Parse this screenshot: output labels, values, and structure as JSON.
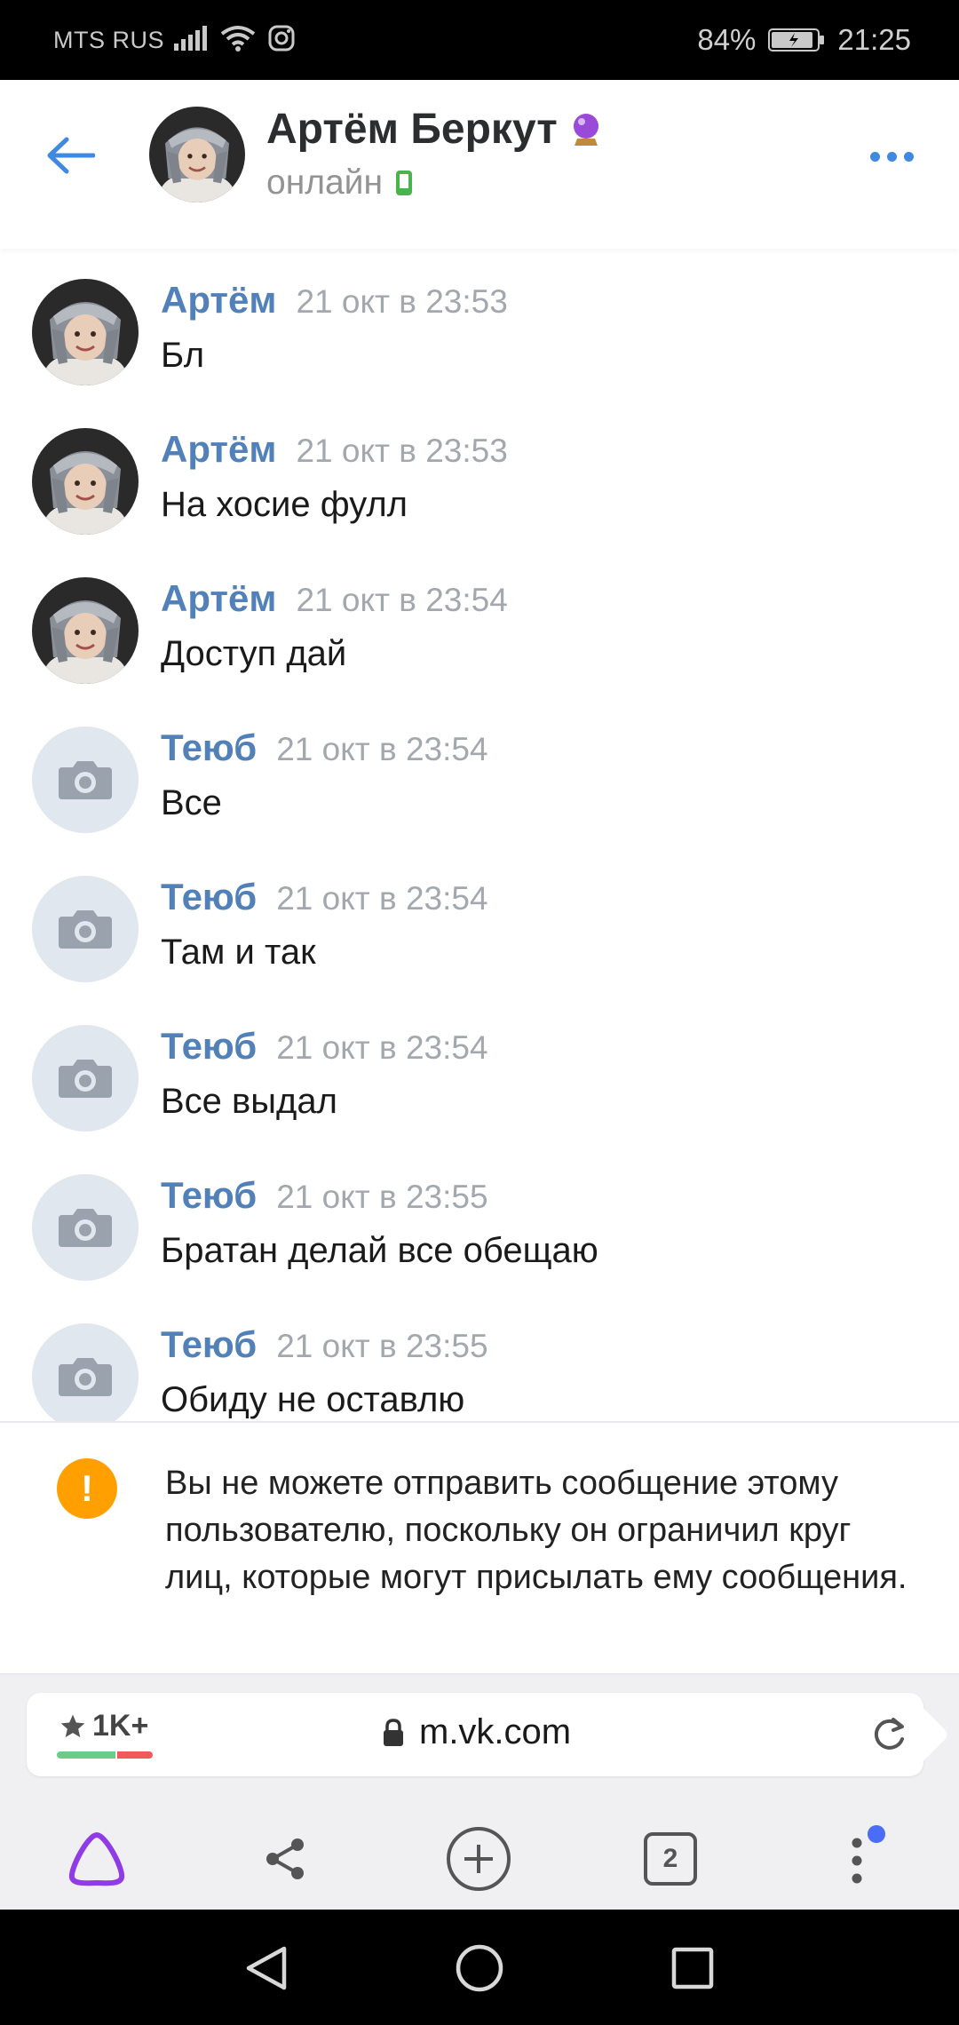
{
  "status_bar": {
    "carrier": "MTS RUS",
    "battery": "84%",
    "time": "21:25"
  },
  "header": {
    "name": "Артём Беркут",
    "status": "онлайн"
  },
  "messages": [
    {
      "author": "Артём",
      "time": "21 окт в 23:53",
      "text": "Бл",
      "avatar": "photo"
    },
    {
      "author": "Артём",
      "time": "21 окт в 23:53",
      "text": "На хосие фулл",
      "avatar": "photo"
    },
    {
      "author": "Артём",
      "time": "21 окт в 23:54",
      "text": "Доступ дай",
      "avatar": "photo"
    },
    {
      "author": "Теюб",
      "time": "21 окт в 23:54",
      "text": "Все",
      "avatar": "camera-placeholder"
    },
    {
      "author": "Теюб",
      "time": "21 окт в 23:54",
      "text": "Там и так",
      "avatar": "camera-placeholder"
    },
    {
      "author": "Теюб",
      "time": "21 окт в 23:54",
      "text": "Все выдал",
      "avatar": "camera-placeholder"
    },
    {
      "author": "Теюб",
      "time": "21 окт в 23:55",
      "text": "Братан делай все обещаю",
      "avatar": "camera-placeholder"
    },
    {
      "author": "Теюб",
      "time": "21 окт в 23:55",
      "text": "Обиду не оставлю",
      "avatar": "camera-placeholder"
    }
  ],
  "notice": {
    "text": "Вы не можете отправить сообщение этому пользователю, поскольку он ограничил круг лиц, которые могут присылать ему сообщения."
  },
  "browser": {
    "rating": "1K+",
    "url": "m.vk.com",
    "tabs_count": "2"
  },
  "colors": {
    "accent": "#3f8ae0",
    "author": "#5181b8",
    "warning": "#ffa000",
    "alice": "#8f3ce6"
  }
}
